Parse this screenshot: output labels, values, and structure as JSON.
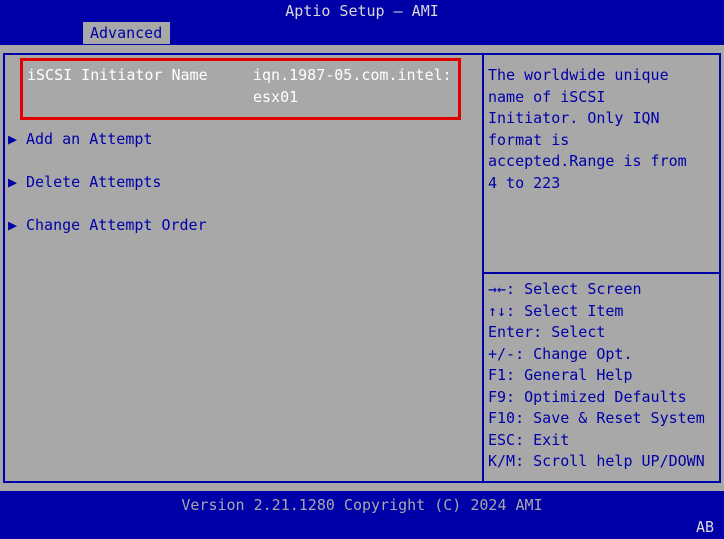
{
  "header": {
    "title": "Aptio Setup – AMI",
    "tab": "Advanced"
  },
  "menu": {
    "initiator": {
      "label": "iSCSI Initiator Name",
      "value_line1": "iqn.1987-05.com.intel:",
      "value_line2": "esx01"
    },
    "items": [
      {
        "arrow": "▶",
        "label": "Add an Attempt"
      },
      {
        "arrow": "▶",
        "label": "Delete Attempts"
      },
      {
        "arrow": "▶",
        "label": "Change Attempt Order"
      }
    ]
  },
  "help": {
    "lines": [
      "The worldwide unique",
      "name of iSCSI",
      "Initiator. Only IQN",
      "format is",
      "accepted.Range is from",
      "4 to 223"
    ]
  },
  "keys": [
    "→←: Select Screen",
    "↑↓: Select Item",
    "Enter: Select",
    "+/-: Change Opt.",
    "F1: General Help",
    "F9: Optimized Defaults",
    "F10: Save & Reset System",
    "ESC: Exit",
    "K/M: Scroll help UP/DOWN"
  ],
  "footer": {
    "version": "Version 2.21.1280 Copyright (C) 2024 AMI",
    "corner": "AB"
  },
  "colors": {
    "background_blue": "#0000a8",
    "panel_gray": "#a8a8a8",
    "selection_red": "#e00000",
    "selected_text": "#ffffff"
  }
}
